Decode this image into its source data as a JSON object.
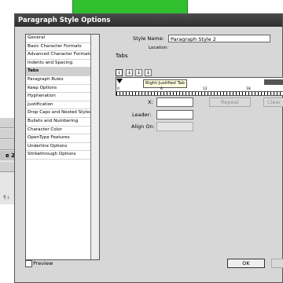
{
  "dialog": {
    "title": "Paragraph Style Options",
    "categories": [
      "General",
      "Basic Character Formats",
      "Advanced Character Formats",
      "Indents and Spacing",
      "Tabs",
      "Paragraph Rules",
      "Keep Options",
      "Hyphenation",
      "Justification",
      "Drop Caps and Nested Styles",
      "Bullets and Numbering",
      "Character Color",
      "OpenType Features",
      "Underline Options",
      "Strikethrough Options"
    ],
    "selected_category": "Tabs",
    "style_name_label": "Style Name:",
    "style_name_value": "Paragraph Style 2",
    "location_label": "Location:",
    "section_title": "Tabs",
    "tab_alignment_buttons": [
      "left-justified-tab",
      "center-justified-tab",
      "right-justified-tab",
      "align-to-decimal-tab"
    ],
    "ruler": {
      "tooltip": "Right-Justified Tab",
      "labels": [
        "0",
        "6",
        "12",
        "18"
      ]
    },
    "x_label": "X:",
    "leader_label": "Leader:",
    "align_on_label": "Align On:",
    "repeat_label": "Repeat",
    "clear_label": "Clear",
    "preview_label": "Preview",
    "ok_label": "OK"
  },
  "background": {
    "panel_selected_text": "e 2"
  }
}
